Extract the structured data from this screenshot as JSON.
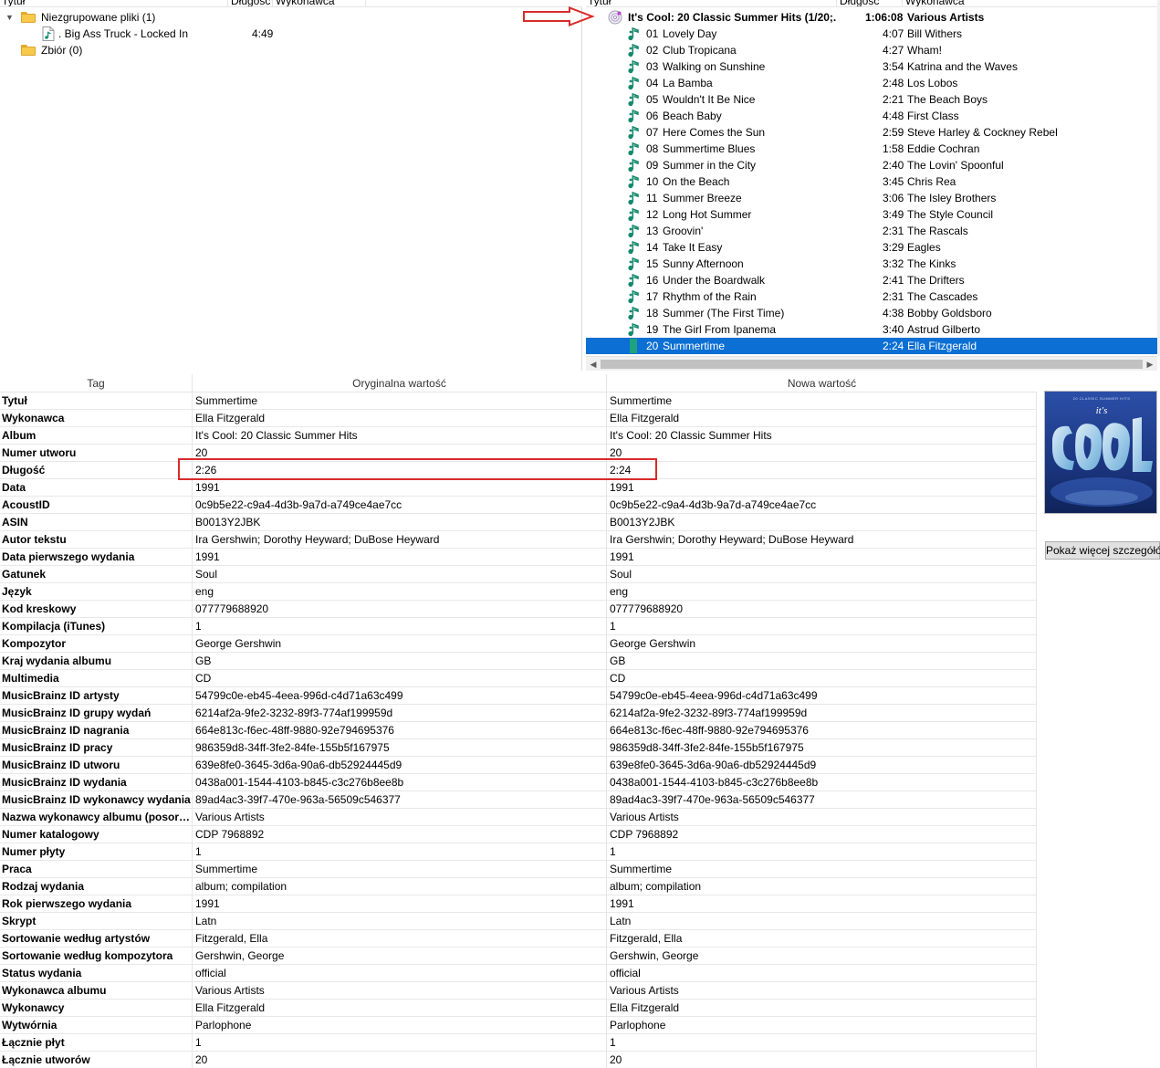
{
  "left_panel": {
    "columns": {
      "title": "Tytuł",
      "length": "Długość",
      "artist": "Wykonawca"
    },
    "tree": [
      {
        "label": "Niezgrupowane pliki (1)",
        "expanded": true
      },
      {
        "label": ". Big Ass Truck - Locked In",
        "length": "4:49"
      },
      {
        "label": "Zbiór (0)"
      }
    ]
  },
  "right_panel": {
    "columns": {
      "title": "Tytuł",
      "length": "Długość",
      "artist": "Wykonawca"
    },
    "album": {
      "title": "It's Cool: 20 Classic Summer Hits (1/20;...",
      "length": "1:06:08",
      "artist": "Various Artists"
    },
    "tracks": [
      {
        "num": "01",
        "title": "Lovely Day",
        "length": "4:07",
        "artist": "Bill Withers"
      },
      {
        "num": "02",
        "title": "Club Tropicana",
        "length": "4:27",
        "artist": "Wham!"
      },
      {
        "num": "03",
        "title": "Walking on Sunshine",
        "length": "3:54",
        "artist": "Katrina and the Waves"
      },
      {
        "num": "04",
        "title": "La Bamba",
        "length": "2:48",
        "artist": "Los Lobos"
      },
      {
        "num": "05",
        "title": "Wouldn't It Be Nice",
        "length": "2:21",
        "artist": "The Beach Boys"
      },
      {
        "num": "06",
        "title": "Beach Baby",
        "length": "4:48",
        "artist": "First Class"
      },
      {
        "num": "07",
        "title": "Here Comes the Sun",
        "length": "2:59",
        "artist": "Steve Harley & Cockney Rebel"
      },
      {
        "num": "08",
        "title": "Summertime Blues",
        "length": "1:58",
        "artist": "Eddie Cochran"
      },
      {
        "num": "09",
        "title": "Summer in the City",
        "length": "2:40",
        "artist": "The Lovin' Spoonful"
      },
      {
        "num": "10",
        "title": "On the Beach",
        "length": "3:45",
        "artist": "Chris Rea"
      },
      {
        "num": "11",
        "title": "Summer Breeze",
        "length": "3:06",
        "artist": "The Isley Brothers"
      },
      {
        "num": "12",
        "title": "Long Hot Summer",
        "length": "3:49",
        "artist": "The Style Council"
      },
      {
        "num": "13",
        "title": "Groovin'",
        "length": "2:31",
        "artist": "The Rascals"
      },
      {
        "num": "14",
        "title": "Take It Easy",
        "length": "3:29",
        "artist": "Eagles"
      },
      {
        "num": "15",
        "title": "Sunny Afternoon",
        "length": "3:32",
        "artist": "The Kinks"
      },
      {
        "num": "16",
        "title": "Under the Boardwalk",
        "length": "2:41",
        "artist": "The Drifters"
      },
      {
        "num": "17",
        "title": "Rhythm of the Rain",
        "length": "2:31",
        "artist": "The Cascades"
      },
      {
        "num": "18",
        "title": "Summer (The First Time)",
        "length": "4:38",
        "artist": "Bobby Goldsboro"
      },
      {
        "num": "19",
        "title": "The Girl From Ipanema",
        "length": "3:40",
        "artist": "Astrud Gilberto"
      },
      {
        "num": "20",
        "title": "Summertime",
        "length": "2:24",
        "artist": "Ella Fitzgerald",
        "selected": true
      }
    ]
  },
  "tag_table": {
    "headers": {
      "tag": "Tag",
      "original": "Oryginalna wartość",
      "new": "Nowa wartość"
    },
    "rows": [
      [
        "Tytuł",
        "Summertime",
        "Summertime"
      ],
      [
        "Wykonawca",
        "Ella Fitzgerald",
        "Ella Fitzgerald"
      ],
      [
        "Album",
        "It's Cool: 20 Classic Summer Hits",
        "It's Cool: 20 Classic Summer Hits"
      ],
      [
        "Numer utworu",
        "20",
        "20"
      ],
      [
        "Długość",
        "2:26",
        "2:24"
      ],
      [
        "Data",
        "1991",
        "1991"
      ],
      [
        "AcoustID",
        "0c9b5e22-c9a4-4d3b-9a7d-a749ce4ae7cc",
        "0c9b5e22-c9a4-4d3b-9a7d-a749ce4ae7cc"
      ],
      [
        "ASIN",
        "B0013Y2JBK",
        "B0013Y2JBK"
      ],
      [
        "Autor tekstu",
        "Ira Gershwin; Dorothy Heyward; DuBose Heyward",
        "Ira Gershwin; Dorothy Heyward; DuBose Heyward"
      ],
      [
        "Data pierwszego wydania",
        "1991",
        "1991"
      ],
      [
        "Gatunek",
        "Soul",
        "Soul"
      ],
      [
        "Język",
        "eng",
        "eng"
      ],
      [
        "Kod kreskowy",
        "077779688920",
        "077779688920"
      ],
      [
        "Kompilacja (iTunes)",
        "1",
        "1"
      ],
      [
        "Kompozytor",
        "George Gershwin",
        "George Gershwin"
      ],
      [
        "Kraj wydania albumu",
        "GB",
        "GB"
      ],
      [
        "Multimedia",
        "CD",
        "CD"
      ],
      [
        "MusicBrainz ID artysty",
        "54799c0e-eb45-4eea-996d-c4d71a63c499",
        "54799c0e-eb45-4eea-996d-c4d71a63c499"
      ],
      [
        "MusicBrainz ID grupy wydań",
        "6214af2a-9fe2-3232-89f3-774af199959d",
        "6214af2a-9fe2-3232-89f3-774af199959d"
      ],
      [
        "MusicBrainz ID nagrania",
        "664e813c-f6ec-48ff-9880-92e794695376",
        "664e813c-f6ec-48ff-9880-92e794695376"
      ],
      [
        "MusicBrainz ID pracy",
        "986359d8-34ff-3fe2-84fe-155b5f167975",
        "986359d8-34ff-3fe2-84fe-155b5f167975"
      ],
      [
        "MusicBrainz ID utworu",
        "639e8fe0-3645-3d6a-90a6-db52924445d9",
        "639e8fe0-3645-3d6a-90a6-db52924445d9"
      ],
      [
        "MusicBrainz ID wydania",
        "0438a001-1544-4103-b845-c3c276b8ee8b",
        "0438a001-1544-4103-b845-c3c276b8ee8b"
      ],
      [
        "MusicBrainz ID wykonawcy wydania",
        "89ad4ac3-39f7-470e-963a-56509c546377",
        "89ad4ac3-39f7-470e-963a-56509c546377"
      ],
      [
        "Nazwa wykonawcy albumu (posort...",
        "Various Artists",
        "Various Artists"
      ],
      [
        "Numer katalogowy",
        "CDP 7968892",
        "CDP 7968892"
      ],
      [
        "Numer płyty",
        "1",
        "1"
      ],
      [
        "Praca",
        "Summertime",
        "Summertime"
      ],
      [
        "Rodzaj wydania",
        "album; compilation",
        "album; compilation"
      ],
      [
        "Rok pierwszego wydania",
        "1991",
        "1991"
      ],
      [
        "Skrypt",
        "Latn",
        "Latn"
      ],
      [
        "Sortowanie według artystów",
        "Fitzgerald, Ella",
        "Fitzgerald, Ella"
      ],
      [
        "Sortowanie według kompozytora",
        "Gershwin, George",
        "Gershwin, George"
      ],
      [
        "Status wydania",
        "official",
        "official"
      ],
      [
        "Wykonawca albumu",
        "Various Artists",
        "Various Artists"
      ],
      [
        "Wykonawcy",
        "Ella Fitzgerald",
        "Ella Fitzgerald"
      ],
      [
        "Wytwórnia",
        "Parlophone",
        "Parlophone"
      ],
      [
        "Łącznie płyt",
        "1",
        "1"
      ],
      [
        "Łącznie utworów",
        "20",
        "20"
      ]
    ]
  },
  "cover_art": {
    "text": "it's",
    "logo_text": "COOL"
  },
  "more_details_button": "Pokaż więcej szczegółów",
  "colors": {
    "selection": "#0b6fd3",
    "annotation": "#d92b2b",
    "note_icon": "#118b6f",
    "folder": "#f8c94a"
  }
}
